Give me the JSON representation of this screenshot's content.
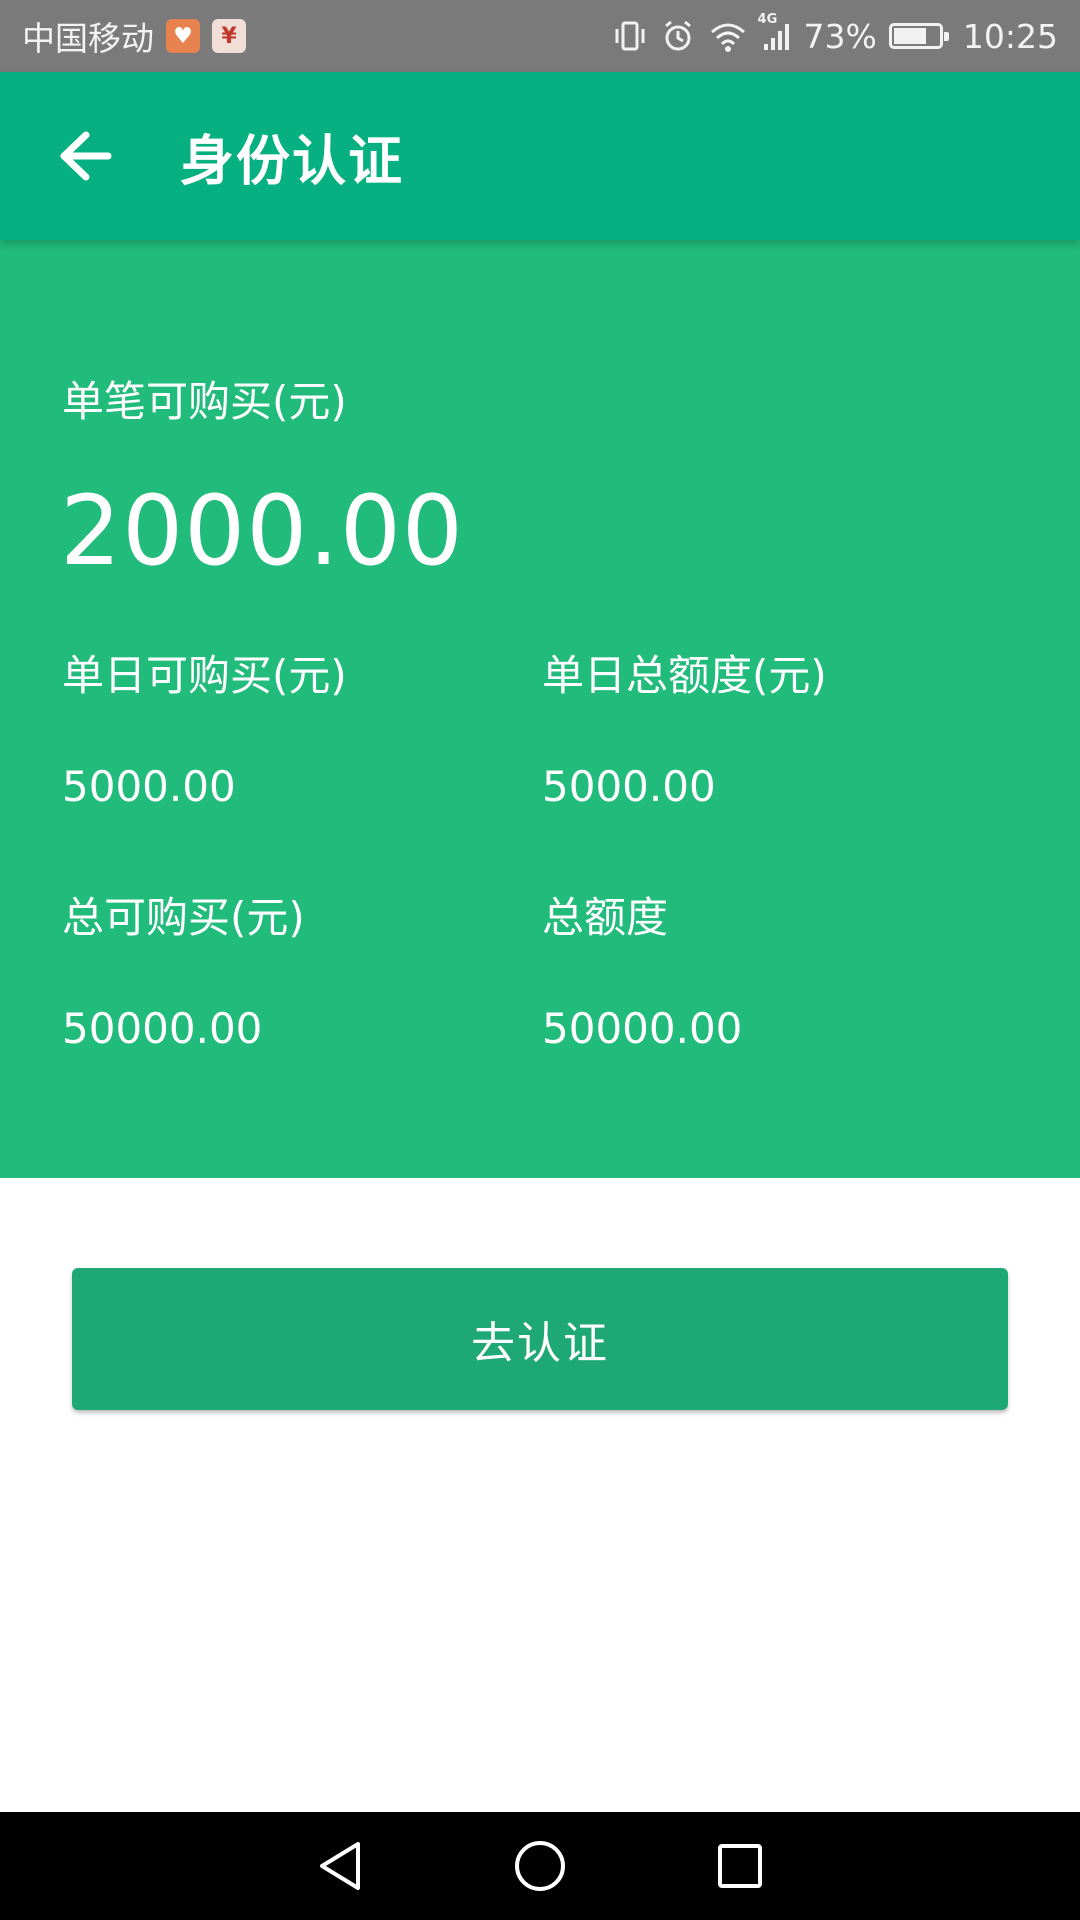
{
  "status_bar": {
    "carrier": "中国移动",
    "network": "4G",
    "battery": "73%",
    "battery_level": 0.73,
    "time": "10:25",
    "icons": [
      "health-app-icon",
      "yen-app-icon",
      "vibrate-icon",
      "alarm-icon",
      "wifi-icon",
      "signal-icon",
      "battery-icon"
    ]
  },
  "header": {
    "title": "身份认证",
    "back_icon": "arrow-left-icon"
  },
  "limits": {
    "single_label": "单笔可购买(元)",
    "single_value": "2000.00",
    "daily_available_label": "单日可购买(元)",
    "daily_available_value": "5000.00",
    "daily_total_label": "单日总额度(元)",
    "daily_total_value": "5000.00",
    "total_available_label": "总可购买(元)",
    "total_available_value": "50000.00",
    "total_limit_label": "总额度",
    "total_limit_value": "50000.00"
  },
  "actions": {
    "verify_label": "去认证"
  },
  "nav": {
    "icons": [
      "back-triangle-icon",
      "home-circle-icon",
      "recents-square-icon"
    ]
  },
  "colors": {
    "app_bar": "#06b080",
    "panel": "#21bb7b",
    "button": "#1ea876",
    "status_bar": "#7a7a7a",
    "nav_bar": "#000000"
  }
}
